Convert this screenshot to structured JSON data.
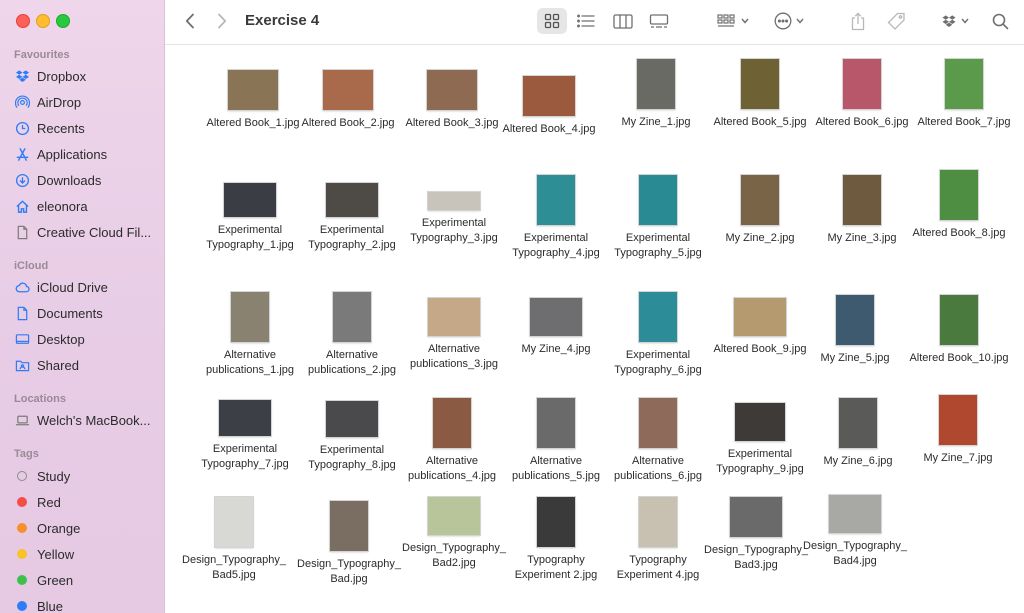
{
  "window": {
    "title": "Exercise 4"
  },
  "sidebar": {
    "favourites_label": "Favourites",
    "favourites": [
      {
        "label": "Dropbox",
        "icon": "dropbox-icon"
      },
      {
        "label": "AirDrop",
        "icon": "airdrop-icon"
      },
      {
        "label": "Recents",
        "icon": "clock-icon"
      },
      {
        "label": "Applications",
        "icon": "applications-icon"
      },
      {
        "label": "Downloads",
        "icon": "download-icon"
      },
      {
        "label": "eleonora",
        "icon": "home-icon"
      },
      {
        "label": "Creative Cloud Fil...",
        "icon": "document-icon"
      }
    ],
    "icloud_label": "iCloud",
    "icloud": [
      {
        "label": "iCloud Drive",
        "icon": "cloud-icon"
      },
      {
        "label": "Documents",
        "icon": "document-icon"
      },
      {
        "label": "Desktop",
        "icon": "desktop-icon"
      },
      {
        "label": "Shared",
        "icon": "shared-folder-icon"
      }
    ],
    "locations_label": "Locations",
    "locations": [
      {
        "label": "Welch's MacBook...",
        "icon": "laptop-icon"
      }
    ],
    "tags_label": "Tags",
    "tags": [
      {
        "label": "Study",
        "color": "none"
      },
      {
        "label": "Red",
        "color": "#f24e46"
      },
      {
        "label": "Orange",
        "color": "#f7902c"
      },
      {
        "label": "Yellow",
        "color": "#f6c426"
      },
      {
        "label": "Green",
        "color": "#3fc04c"
      },
      {
        "label": "Blue",
        "color": "#2f7cf6"
      }
    ]
  },
  "accent_color": "#3478f6",
  "files": [
    {
      "name": "Altered Book_1.jpg",
      "thumb": "#8a7456"
    },
    {
      "name": "Altered Book_2.jpg",
      "thumb": "#a86a4a"
    },
    {
      "name": "Altered Book_3.jpg",
      "thumb": "#8e6a52"
    },
    {
      "name": "Altered Book_4.jpg",
      "thumb": "#9b5a3e"
    },
    {
      "name": "My Zine_1.jpg",
      "thumb": "#6a6a64"
    },
    {
      "name": "Altered Book_5.jpg",
      "thumb": "#6e6234"
    },
    {
      "name": "Altered Book_6.jpg",
      "thumb": "#b8566a"
    },
    {
      "name": "Altered Book_7.jpg",
      "thumb": "#5a9a4a"
    },
    {
      "name": "Experimental Typography_1.jpg",
      "thumb": "#3a3e44"
    },
    {
      "name": "Experimental Typography_2.jpg",
      "thumb": "#4e4a46"
    },
    {
      "name": "Experimental Typography_3.jpg",
      "thumb": "#c8c4bc"
    },
    {
      "name": "Experimental Typography_4.jpg",
      "thumb": "#2e8e96"
    },
    {
      "name": "Experimental Typography_5.jpg",
      "thumb": "#2a8a94"
    },
    {
      "name": "My Zine_2.jpg",
      "thumb": "#7a6448"
    },
    {
      "name": "My Zine_3.jpg",
      "thumb": "#6e5a3e"
    },
    {
      "name": "Altered Book_8.jpg",
      "thumb": "#4e8e42"
    },
    {
      "name": "Alternative publications_1.jpg",
      "thumb": "#8a8270"
    },
    {
      "name": "Alternative publications_2.jpg",
      "thumb": "#7a7a7a"
    },
    {
      "name": "Alternative publications_3.jpg",
      "thumb": "#c4a888"
    },
    {
      "name": "My Zine_4.jpg",
      "thumb": "#6e6e70"
    },
    {
      "name": "Experimental Typography_6.jpg",
      "thumb": "#2c8c98"
    },
    {
      "name": "Altered Book_9.jpg",
      "thumb": "#b49a6e"
    },
    {
      "name": "My Zine_5.jpg",
      "thumb": "#3e5a6e"
    },
    {
      "name": "Altered Book_10.jpg",
      "thumb": "#4a7a3e"
    },
    {
      "name": "Experimental Typography_7.jpg",
      "thumb": "#3c4046"
    },
    {
      "name": "Experimental Typography_8.jpg",
      "thumb": "#4a4a4c"
    },
    {
      "name": "Alternative publications_4.jpg",
      "thumb": "#8a5a42"
    },
    {
      "name": "Alternative publications_5.jpg",
      "thumb": "#6a6a6a"
    },
    {
      "name": "Alternative publications_6.jpg",
      "thumb": "#8e6a5a"
    },
    {
      "name": "Experimental Typography_9.jpg",
      "thumb": "#3e3a38"
    },
    {
      "name": "My Zine_6.jpg",
      "thumb": "#5a5a58"
    },
    {
      "name": "My Zine_7.jpg",
      "thumb": "#b04830"
    },
    {
      "name": "Design_Typography_Bad5.jpg",
      "thumb": "#d8d8d4"
    },
    {
      "name": "Design_Typography_Bad.jpg",
      "thumb": "#7a6e62"
    },
    {
      "name": "Design_Typography_Bad2.jpg",
      "thumb": "#b8c49a"
    },
    {
      "name": "Typography Experiment 2.jpg",
      "thumb": "#3a3a3a"
    },
    {
      "name": "Typography Experiment 4.jpg",
      "thumb": "#c8c0b0"
    },
    {
      "name": "Design_Typography_Bad3.jpg",
      "thumb": "#6a6a6a"
    },
    {
      "name": "Design_Typography_Bad4.jpg",
      "thumb": "#a8a8a4"
    }
  ]
}
